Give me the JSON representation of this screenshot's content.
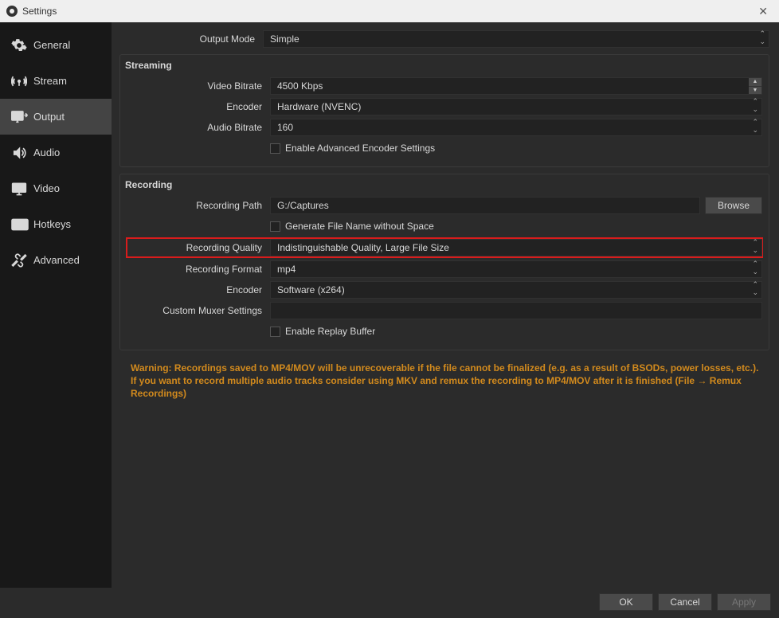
{
  "window": {
    "title": "Settings"
  },
  "sidebar": {
    "items": [
      {
        "label": "General"
      },
      {
        "label": "Stream"
      },
      {
        "label": "Output"
      },
      {
        "label": "Audio"
      },
      {
        "label": "Video"
      },
      {
        "label": "Hotkeys"
      },
      {
        "label": "Advanced"
      }
    ]
  },
  "output_mode": {
    "label": "Output Mode",
    "value": "Simple"
  },
  "streaming": {
    "title": "Streaming",
    "video_bitrate": {
      "label": "Video Bitrate",
      "value": "4500 Kbps"
    },
    "encoder": {
      "label": "Encoder",
      "value": "Hardware (NVENC)"
    },
    "audio_bitrate": {
      "label": "Audio Bitrate",
      "value": "160"
    },
    "advanced_checkbox": "Enable Advanced Encoder Settings"
  },
  "recording": {
    "title": "Recording",
    "path": {
      "label": "Recording Path",
      "value": "G:/Captures"
    },
    "browse": "Browse",
    "no_space_checkbox": "Generate File Name without Space",
    "quality": {
      "label": "Recording Quality",
      "value": "Indistinguishable Quality, Large File Size"
    },
    "format": {
      "label": "Recording Format",
      "value": "mp4"
    },
    "encoder": {
      "label": "Encoder",
      "value": "Software (x264)"
    },
    "muxer": {
      "label": "Custom Muxer Settings",
      "value": ""
    },
    "replay_checkbox": "Enable Replay Buffer"
  },
  "warning_text": "Warning: Recordings saved to MP4/MOV will be unrecoverable if the file cannot be finalized (e.g. as a result of BSODs, power losses, etc.). If you want to record multiple audio tracks consider using MKV and remux the recording to MP4/MOV after it is finished (File → Remux Recordings)",
  "footer": {
    "ok": "OK",
    "cancel": "Cancel",
    "apply": "Apply"
  }
}
